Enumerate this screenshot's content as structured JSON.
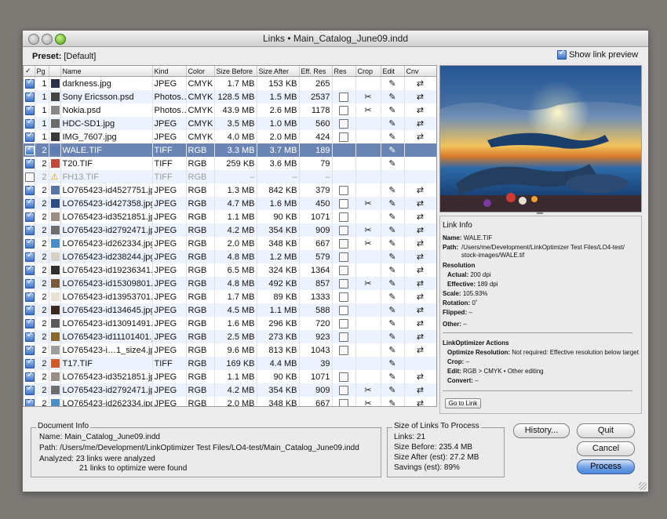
{
  "window": {
    "title": "Links • Main_Catalog_June09.indd"
  },
  "preset": {
    "label": "Preset:",
    "value": "[Default]"
  },
  "show_link_preview": {
    "label": "Show link preview",
    "checked": true
  },
  "table": {
    "columns": [
      "✓",
      "Pg",
      "",
      "Name",
      "Kind",
      "Color",
      "Size Before",
      "Size After",
      "Eff. Res",
      "Res",
      "Crop",
      "Edit",
      "Cnv"
    ],
    "rows": [
      {
        "checked": true,
        "pg": "1",
        "name": "darkness.jpg",
        "kind": "JPEG",
        "color": "CMYK",
        "size_before": "1.7 MB",
        "size_after": "153 KB",
        "eff_res": "265",
        "res": "",
        "crop": "",
        "edit": "pencil-icon",
        "cnv": "convert-icon",
        "thumb": "#2a3048"
      },
      {
        "checked": true,
        "pg": "1",
        "name": "Sony Ericsson.psd",
        "kind": "Photos…",
        "color": "CMYK",
        "size_before": "128.5 MB",
        "size_after": "1.5 MB",
        "eff_res": "2537",
        "res": "checkbox-icon",
        "crop": "scissors-icon",
        "edit": "pencil-icon",
        "cnv": "convert-icon",
        "thumb": "#444"
      },
      {
        "checked": true,
        "pg": "1",
        "name": "Nokia.psd",
        "kind": "Photos…",
        "color": "CMYK",
        "size_before": "43.9 MB",
        "size_after": "2.6 MB",
        "eff_res": "1178",
        "res": "checkbox-icon",
        "crop": "scissors-icon",
        "edit": "pencil-icon",
        "cnv": "convert-icon",
        "thumb": "#888"
      },
      {
        "checked": true,
        "pg": "1",
        "name": "HDC-SD1.jpg",
        "kind": "JPEG",
        "color": "CMYK",
        "size_before": "3.5 MB",
        "size_after": "1.0 MB",
        "eff_res": "560",
        "res": "checkbox-icon",
        "crop": "",
        "edit": "pencil-icon",
        "cnv": "convert-icon",
        "thumb": "#6b6b6b"
      },
      {
        "checked": true,
        "pg": "1",
        "name": "IMG_7607.jpg",
        "kind": "JPEG",
        "color": "CMYK",
        "size_before": "4.0 MB",
        "size_after": "2.0 MB",
        "eff_res": "424",
        "res": "checkbox-icon",
        "crop": "",
        "edit": "pencil-icon",
        "cnv": "convert-icon",
        "thumb": "#3a3a3a"
      },
      {
        "checked": true,
        "pg": "2",
        "name": "WALE.TIF",
        "kind": "TIFF",
        "color": "RGB",
        "size_before": "3.3 MB",
        "size_after": "3.7 MB",
        "eff_res": "189",
        "res": "",
        "crop": "",
        "edit": "pencil-icon",
        "cnv": "",
        "thumb": "#5b7fb4",
        "selected": true
      },
      {
        "checked": true,
        "pg": "2",
        "name": "T20.TIF",
        "kind": "TIFF",
        "color": "RGB",
        "size_before": "259 KB",
        "size_after": "3.6 MB",
        "eff_res": "79",
        "res": "",
        "crop": "",
        "edit": "pencil-icon",
        "cnv": "",
        "thumb": "#c2493a"
      },
      {
        "checked": false,
        "pg": "2",
        "name": "FH13.TIF",
        "kind": "TIFF",
        "color": "RGB",
        "size_before": "–",
        "size_after": "–",
        "eff_res": "–",
        "res": "",
        "crop": "",
        "edit": "",
        "cnv": "",
        "thumb": "warning",
        "dim": true
      },
      {
        "checked": true,
        "pg": "2",
        "name": "LO765423-id4527751.jpg",
        "kind": "JPEG",
        "color": "RGB",
        "size_before": "1.3 MB",
        "size_after": "842 KB",
        "eff_res": "379",
        "res": "checkbox-icon",
        "crop": "",
        "edit": "pencil-icon",
        "cnv": "convert-icon",
        "thumb": "#5677a6"
      },
      {
        "checked": true,
        "pg": "2",
        "name": "LO765423-id427358.jpg",
        "kind": "JPEG",
        "color": "RGB",
        "size_before": "4.7 MB",
        "size_after": "1.6 MB",
        "eff_res": "450",
        "res": "checkbox-icon",
        "crop": "scissors-icon",
        "edit": "pencil-icon",
        "cnv": "convert-icon",
        "thumb": "#2c4c86"
      },
      {
        "checked": true,
        "pg": "2",
        "name": "LO765423-id3521851.jpg",
        "kind": "JPEG",
        "color": "RGB",
        "size_before": "1.1 MB",
        "size_after": "90 KB",
        "eff_res": "1071",
        "res": "checkbox-icon",
        "crop": "",
        "edit": "pencil-icon",
        "cnv": "convert-icon",
        "thumb": "#9a8f84"
      },
      {
        "checked": true,
        "pg": "2",
        "name": "LO765423-id2792471.jpg",
        "kind": "JPEG",
        "color": "RGB",
        "size_before": "4.2 MB",
        "size_after": "354 KB",
        "eff_res": "909",
        "res": "checkbox-icon",
        "crop": "scissors-icon",
        "edit": "pencil-icon",
        "cnv": "convert-icon",
        "thumb": "#6e6e6e"
      },
      {
        "checked": true,
        "pg": "2",
        "name": "LO765423-id262334.jpg",
        "kind": "JPEG",
        "color": "RGB",
        "size_before": "2.0 MB",
        "size_after": "348 KB",
        "eff_res": "667",
        "res": "checkbox-icon",
        "crop": "scissors-icon",
        "edit": "pencil-icon",
        "cnv": "convert-icon",
        "thumb": "#4a8ec9"
      },
      {
        "checked": true,
        "pg": "2",
        "name": "LO765423-id238244.jpg",
        "kind": "JPEG",
        "color": "RGB",
        "size_before": "4.8 MB",
        "size_after": "1.2 MB",
        "eff_res": "579",
        "res": "checkbox-icon",
        "crop": "",
        "edit": "pencil-icon",
        "cnv": "convert-icon",
        "thumb": "#d7d0c4"
      },
      {
        "checked": true,
        "pg": "2",
        "name": "LO765423-id19236341.jpg",
        "kind": "JPEG",
        "color": "RGB",
        "size_before": "6.5 MB",
        "size_after": "324 KB",
        "eff_res": "1364",
        "res": "checkbox-icon",
        "crop": "",
        "edit": "pencil-icon",
        "cnv": "convert-icon",
        "thumb": "#2f2f2f"
      },
      {
        "checked": true,
        "pg": "2",
        "name": "LO765423-id15309801.jpg",
        "kind": "JPEG",
        "color": "RGB",
        "size_before": "4.8 MB",
        "size_after": "492 KB",
        "eff_res": "857",
        "res": "checkbox-icon",
        "crop": "scissors-icon",
        "edit": "pencil-icon",
        "cnv": "convert-icon",
        "thumb": "#7a5b3c"
      },
      {
        "checked": true,
        "pg": "2",
        "name": "LO765423-id13953701.jpg",
        "kind": "JPEG",
        "color": "RGB",
        "size_before": "1.7 MB",
        "size_after": "89 KB",
        "eff_res": "1333",
        "res": "checkbox-icon",
        "crop": "",
        "edit": "pencil-icon",
        "cnv": "convert-icon",
        "thumb": "#e8e2d4"
      },
      {
        "checked": true,
        "pg": "2",
        "name": "LO765423-id134645.jpg",
        "kind": "JPEG",
        "color": "RGB",
        "size_before": "4.5 MB",
        "size_after": "1.1 MB",
        "eff_res": "588",
        "res": "checkbox-icon",
        "crop": "",
        "edit": "pencil-icon",
        "cnv": "convert-icon",
        "thumb": "#3b2a20"
      },
      {
        "checked": true,
        "pg": "2",
        "name": "LO765423-id13091491.jpg",
        "kind": "JPEG",
        "color": "RGB",
        "size_before": "1.6 MB",
        "size_after": "296 KB",
        "eff_res": "720",
        "res": "checkbox-icon",
        "crop": "",
        "edit": "pencil-icon",
        "cnv": "convert-icon",
        "thumb": "#5a5a5a"
      },
      {
        "checked": true,
        "pg": "2",
        "name": "LO765423-id11101401.jpg",
        "kind": "JPEG",
        "color": "RGB",
        "size_before": "2.5 MB",
        "size_after": "273 KB",
        "eff_res": "923",
        "res": "checkbox-icon",
        "crop": "",
        "edit": "pencil-icon",
        "cnv": "convert-icon",
        "thumb": "#8a6a2c"
      },
      {
        "checked": true,
        "pg": "2",
        "name": "LO765423-i…1_size4.jpg",
        "kind": "JPEG",
        "color": "RGB",
        "size_before": "9.6 MB",
        "size_after": "813 KB",
        "eff_res": "1043",
        "res": "checkbox-icon",
        "crop": "",
        "edit": "pencil-icon",
        "cnv": "convert-icon",
        "thumb": "#9d9d9d"
      },
      {
        "checked": true,
        "pg": "2",
        "name": "T17.TIF",
        "kind": "TIFF",
        "color": "RGB",
        "size_before": "169 KB",
        "size_after": "4.4 MB",
        "eff_res": "39",
        "res": "",
        "crop": "",
        "edit": "pencil-icon",
        "cnv": "",
        "thumb": "#d05a28"
      },
      {
        "checked": true,
        "pg": "2",
        "name": "LO765423-id3521851.jpg",
        "kind": "JPEG",
        "color": "RGB",
        "size_before": "1.1 MB",
        "size_after": "90 KB",
        "eff_res": "1071",
        "res": "checkbox-icon",
        "crop": "",
        "edit": "pencil-icon",
        "cnv": "convert-icon",
        "thumb": "#9a8f84"
      },
      {
        "checked": true,
        "pg": "2",
        "name": "LO765423-id2792471.jpg",
        "kind": "JPEG",
        "color": "RGB",
        "size_before": "4.2 MB",
        "size_after": "354 KB",
        "eff_res": "909",
        "res": "checkbox-icon",
        "crop": "scissors-icon",
        "edit": "pencil-icon",
        "cnv": "convert-icon",
        "thumb": "#6e6e6e"
      },
      {
        "checked": true,
        "pg": "2",
        "name": "LO765423-id262334.jpg",
        "kind": "JPEG",
        "color": "RGB",
        "size_before": "2.0 MB",
        "size_after": "348 KB",
        "eff_res": "667",
        "res": "checkbox-icon",
        "crop": "scissors-icon",
        "edit": "pencil-icon",
        "cnv": "convert-icon",
        "thumb": "#4a8ec9"
      }
    ]
  },
  "link_info": {
    "title": "Link Info",
    "name_label": "Name:",
    "name": "WALE.TIF",
    "path_label": "Path:",
    "path_1": "/Users/me/Development/LinkOptimizer Test Files/LO4-test/",
    "path_2": "stock-images/WALE.tif",
    "resolution_title": "Resolution",
    "actual_label": "Actual:",
    "actual": "200 dpi",
    "effective_label": "Effective:",
    "effective": "189 dpi",
    "scale_label": "Scale:",
    "scale": "105.93%",
    "rotation_label": "Rotation:",
    "rotation": "0˚",
    "flipped_label": "Flipped:",
    "flipped": "–",
    "other_label": "Other:",
    "other": "–",
    "actions_title": "LinkOptimizer Actions",
    "opt_res_label": "Optimize Resolution:",
    "opt_res": "Not required: Effective resolution below target",
    "crop_label": "Crop:",
    "crop": "–",
    "edit_label": "Edit:",
    "edit": "RGB > CMYK • Other editing",
    "convert_label": "Convert:",
    "convert": "–",
    "goto_button": "Go to Link"
  },
  "document_info": {
    "legend": "Document Info",
    "name_label": "Name:",
    "name": "Main_Catalog_June09.indd",
    "path_label": "Path:",
    "path": "/Users/me/Development/LinkOptimizer Test Files/LO4-test/Main_Catalog_June09.indd",
    "analyzed_label": "Analyzed:",
    "analyzed_1": "23 links were analyzed",
    "analyzed_2": "21 links to optimize were found"
  },
  "size_info": {
    "legend": "Size of Links To Process",
    "links": "Links: 21",
    "size_before": "Size Before: 235.4 MB",
    "size_after": "Size After (est): 27.2 MB",
    "savings": "Savings (est): 89%"
  },
  "buttons": {
    "history": "History...",
    "quit": "Quit",
    "cancel": "Cancel",
    "process": "Process"
  }
}
